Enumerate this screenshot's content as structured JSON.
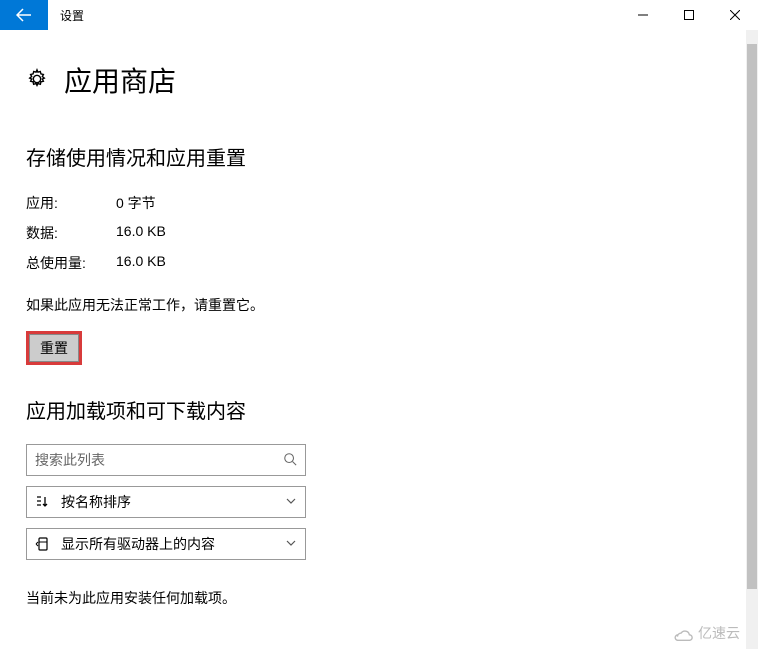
{
  "window": {
    "title": "设置"
  },
  "page": {
    "title": "应用商店"
  },
  "storage": {
    "heading": "存储使用情况和应用重置",
    "rows": [
      {
        "label": "应用:",
        "value": "0 字节"
      },
      {
        "label": "数据:",
        "value": "16.0 KB"
      },
      {
        "label": "总使用量:",
        "value": "16.0 KB"
      }
    ],
    "reset_help": "如果此应用无法正常工作，请重置它。",
    "reset_button": "重置"
  },
  "addons": {
    "heading": "应用加载项和可下载内容",
    "search_placeholder": "搜索此列表",
    "sort_label": "按名称排序",
    "filter_label": "显示所有驱动器上的内容",
    "empty_state": "当前未为此应用安装任何加载项。"
  },
  "watermark": "亿速云"
}
